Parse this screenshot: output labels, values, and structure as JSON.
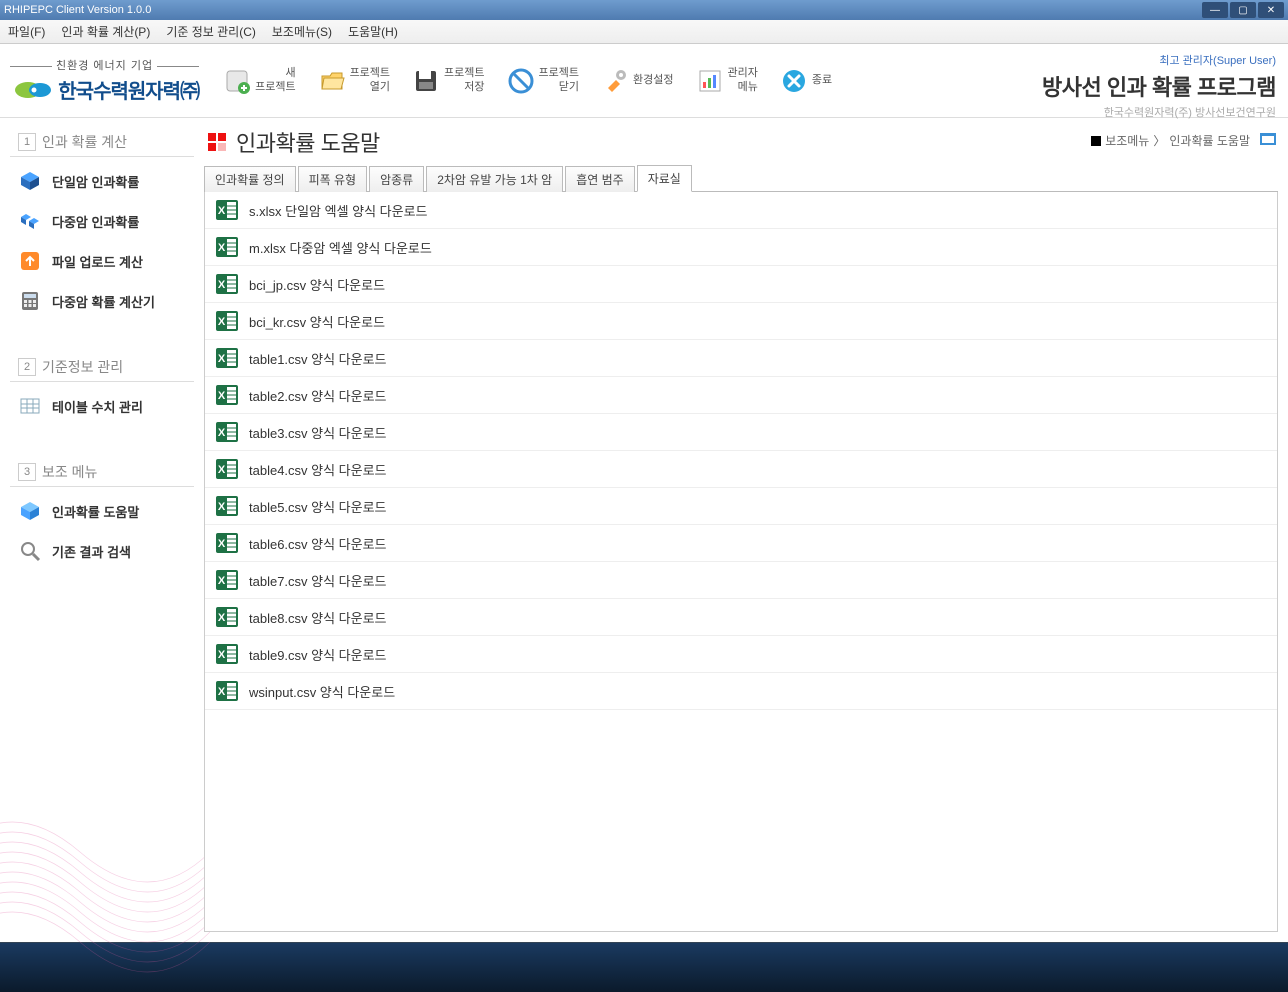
{
  "window": {
    "title": "RHIPEPC Client Version 1.0.0"
  },
  "menu": {
    "file": "파일(F)",
    "calc": "인과 확률 계산(P)",
    "base": "기준 정보 관리(C)",
    "sub": "보조메뉴(S)",
    "help": "도움말(H)"
  },
  "brand": {
    "sub": "친환경 에너지 기업",
    "name": "한국수력원자력㈜"
  },
  "toolbar": {
    "new": "새\n프로젝트",
    "open": "프로젝트\n열기",
    "save": "프로젝트\n저장",
    "close": "프로젝트\n닫기",
    "settings": "환경설정",
    "admin": "관리자\n메뉴",
    "exit": "종료"
  },
  "header": {
    "super_user": "최고 관리자(Super User)",
    "app_title": "방사선 인과 확률 프로그램",
    "app_subtitle": "한국수력원자력(주) 방사선보건연구원"
  },
  "sidebar": {
    "s1": {
      "num": "1",
      "title": "인과 확률 계산"
    },
    "s1_items": [
      "단일암 인과확률",
      "다중암 인과확률",
      "파일 업로드 계산",
      "다중암 확률 계산기"
    ],
    "s2": {
      "num": "2",
      "title": "기준정보 관리"
    },
    "s2_items": [
      "테이블 수치 관리"
    ],
    "s3": {
      "num": "3",
      "title": "보조 메뉴"
    },
    "s3_items": [
      "인과확률 도움말",
      "기존 결과 검색"
    ]
  },
  "page": {
    "title": "인과확률 도움말",
    "breadcrumb_a": "보조메뉴",
    "breadcrumb_b": "인과확률 도움말"
  },
  "tabs": [
    "인과확률 정의",
    "피폭 유형",
    "암종류",
    "2차암 유발 가능 1차 암",
    "흡연 범주",
    "자료실"
  ],
  "active_tab": 5,
  "files": [
    "s.xlsx 단일암 엑셀 양식 다운로드",
    "m.xlsx 다중암 엑셀 양식 다운로드",
    "bci_jp.csv 양식 다운로드",
    "bci_kr.csv 양식 다운로드",
    "table1.csv 양식 다운로드",
    "table2.csv 양식 다운로드",
    "table3.csv 양식 다운로드",
    "table4.csv 양식 다운로드",
    "table5.csv 양식 다운로드",
    "table6.csv 양식 다운로드",
    "table7.csv 양식 다운로드",
    "table8.csv 양식 다운로드",
    "table9.csv 양식 다운로드",
    "wsinput.csv 양식 다운로드"
  ]
}
